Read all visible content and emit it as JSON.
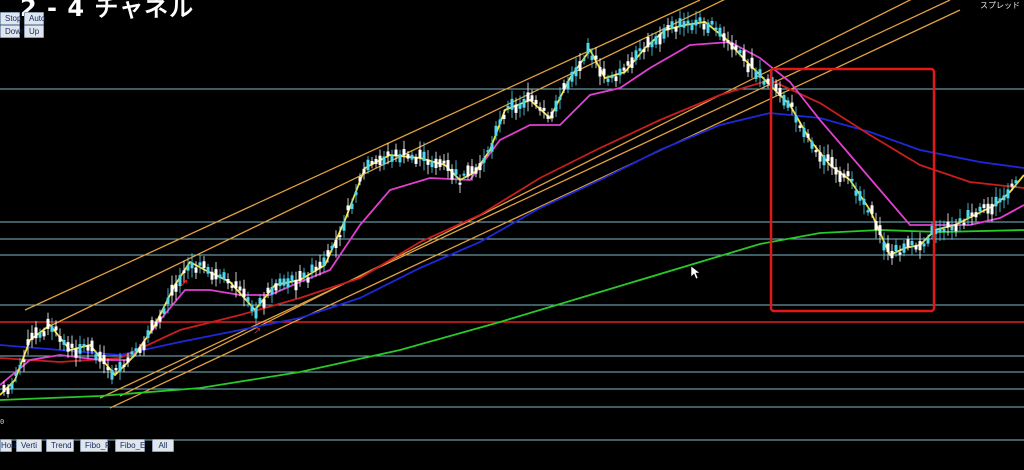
{
  "title_overlay": "2 - 4 チャネル",
  "spread_label": "スプレッド",
  "axis_start_label": "0",
  "top_buttons": [
    {
      "label": "Stop"
    },
    {
      "label": "Auto"
    },
    {
      "label": "Down"
    },
    {
      "label": "Up"
    }
  ],
  "bottom_buttons": [
    {
      "label": "Hoiz"
    },
    {
      "label": "Verti"
    },
    {
      "label": "Trend"
    },
    {
      "label": "Fibo_R"
    },
    {
      "label": "Fibo_E"
    },
    {
      "label": "All"
    }
  ],
  "colors": {
    "background": "#000000",
    "bull_candle": "#4fd8f0",
    "bear_candle": "#ffffff",
    "fast_ma": "#f0e040",
    "mid_ma": "#e040d0",
    "slow_ma_red": "#c81e1e",
    "slow_ma_blue": "#1e28d8",
    "long_ma_green": "#28c828",
    "channel_lines": "#e0a040",
    "horizontal_levels": "#7fb8c8",
    "horizontal_red_level": "#e02020",
    "highlight_box": "#e01818"
  },
  "icons": {
    "cursor": "mouse-pointer-icon"
  }
}
